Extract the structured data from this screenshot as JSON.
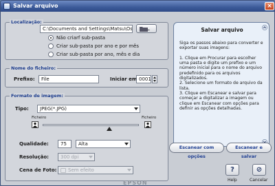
{
  "window": {
    "title": "Salvar arquivo",
    "close_glyph": "×"
  },
  "location": {
    "title": "Localização:",
    "path": "C:\\Documents and Settings\\Matsu\\Os n",
    "options": [
      "Não criarf sub-pasta",
      "Criar sub-pasta por ano e por mês",
      "Criar sub-pasta por ano, mês e dia"
    ],
    "selected_index": 0
  },
  "filename": {
    "title": "Nome do ficheiro:",
    "prefix_label": "Prefixo:",
    "prefix_value": "File",
    "start_label": "Iniciar em:",
    "start_value": "0001"
  },
  "format": {
    "title": "Formato de imagem:",
    "type_label": "Tipo:",
    "type_value": "JPEG(*.JPG)",
    "slider_left_label": "Ficheiro",
    "slider_right_label": "Ficheiro",
    "slider_level": 0.69,
    "quality_label": "Qualidade:",
    "quality_value": "75",
    "quality_level": "Alta",
    "resolution_label": "Resolução:",
    "resolution_value": "300 dpi",
    "scene_label": "Cena de Foto:",
    "scene_value": "Sem efeito"
  },
  "help_panel": {
    "title": "Salvar arquivo",
    "text": "Siga os passos abaixo para converter e exportar suas imagens:\n\n1. Clique em Procurar para escolher uma pasta e digite um prefixo e um número inicial para o nome do arquivo predefinido para os arquivos digitalizados.\n2. Selecione um formato de arquivo da lista.\n3. Clique em Escanear e salvar para começar a digitalizar a imagem ou clique em Escanear com opções para definir as opções detalhadas."
  },
  "actions": {
    "scan_options": "Escanear com opções",
    "scan_save": "Escanear e salvar"
  },
  "footer": {
    "brand": "EPSON",
    "help_label": "Help",
    "help_glyph": "?",
    "cancel_label": "Cancelar",
    "cancel_glyph": "⊘"
  },
  "colors": {
    "title_blue": "#3c5a99",
    "group_title": "#1c3c8c",
    "panel_bg": "#e9f0f9"
  },
  "icons": [
    "folder-icon",
    "chevron-down-icon",
    "person-icon",
    "slider-thumb-icon",
    "help-icon",
    "cancel-icon"
  ]
}
